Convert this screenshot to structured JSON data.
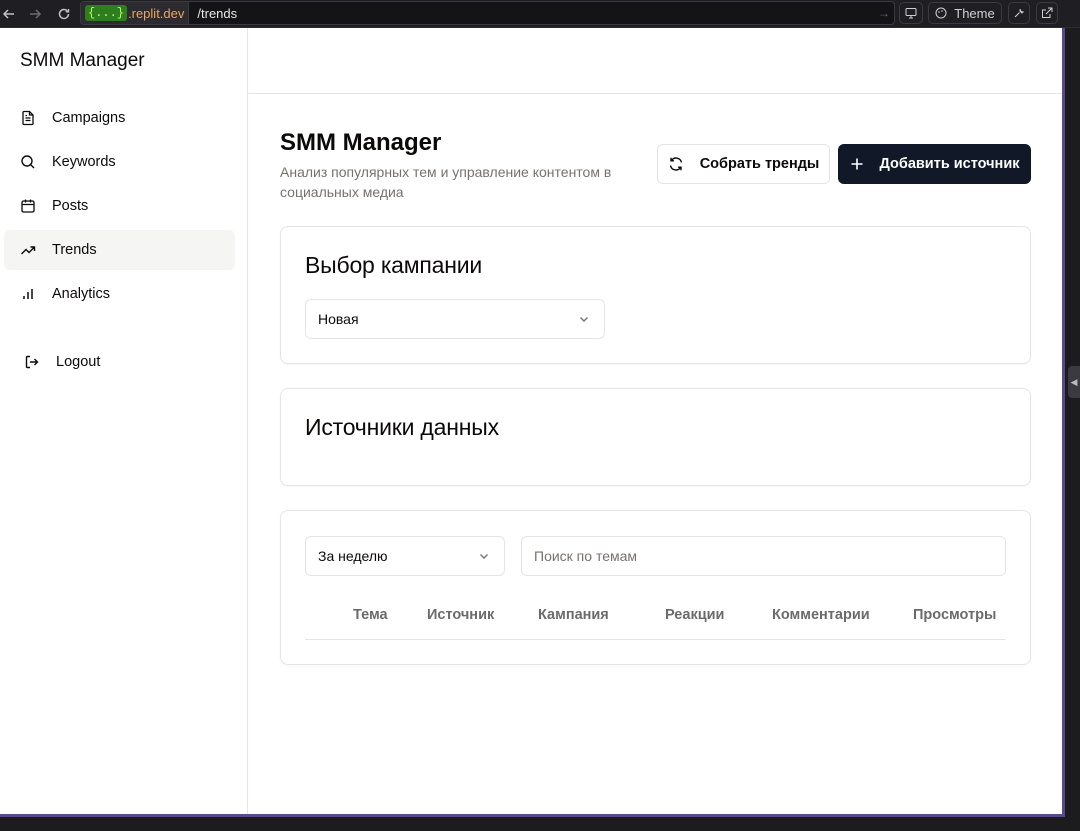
{
  "browser": {
    "url_host_badge": "{...}",
    "url_domain": ".replit.dev",
    "url_path": "/trends",
    "theme_label": "Theme"
  },
  "sidebar": {
    "brand": "SMM Manager",
    "items": [
      {
        "label": "Campaigns",
        "icon": "file-text-icon",
        "active": false
      },
      {
        "label": "Keywords",
        "icon": "search-icon",
        "active": false
      },
      {
        "label": "Posts",
        "icon": "calendar-icon",
        "active": false
      },
      {
        "label": "Trends",
        "icon": "trending-up-icon",
        "active": true
      },
      {
        "label": "Analytics",
        "icon": "bar-chart-icon",
        "active": false
      }
    ],
    "logout_label": "Logout"
  },
  "header": {
    "title": "SMM Manager",
    "subtitle": "Анализ популярных тем и управление контентом в социальных медиа",
    "collect_button": "Собрать тренды",
    "add_source_button": "Добавить источник"
  },
  "campaign_card": {
    "title": "Выбор кампании",
    "selected": "Новая"
  },
  "sources_card": {
    "title": "Источники данных"
  },
  "trends_card": {
    "period_selected": "За неделю",
    "search_placeholder": "Поиск по темам",
    "columns": [
      "Тема",
      "Источник",
      "Кампания",
      "Реакции",
      "Комментарии",
      "Просмотры"
    ]
  },
  "colors": {
    "primary": "#111827",
    "border": "#e7e5e4",
    "muted_text": "#78716c",
    "active_nav_bg": "#f5f5f4"
  }
}
